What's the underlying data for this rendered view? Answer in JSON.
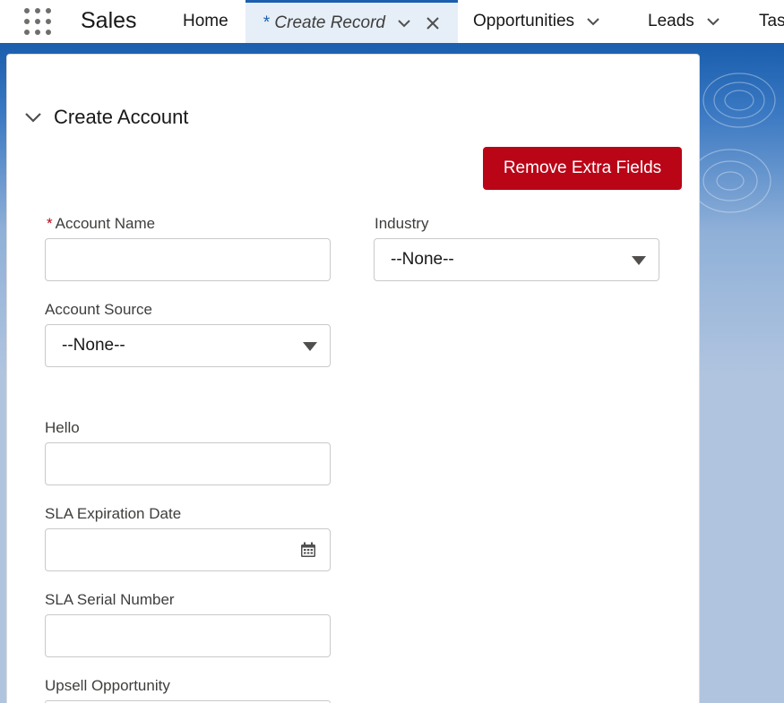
{
  "app": {
    "name": "Sales"
  },
  "nav": {
    "tabs": [
      {
        "label": "Home"
      },
      {
        "label": "Create Record",
        "unsaved_marker": "*"
      },
      {
        "label": "Opportunities"
      },
      {
        "label": "Leads"
      },
      {
        "label": "Tas"
      }
    ]
  },
  "section": {
    "title": "Create Account"
  },
  "actions": {
    "remove_extra_fields": "Remove Extra Fields"
  },
  "form": {
    "account_name": {
      "label": "Account Name",
      "required_marker": "*",
      "value": ""
    },
    "industry": {
      "label": "Industry",
      "value": "--None--"
    },
    "account_source": {
      "label": "Account Source",
      "value": "--None--"
    },
    "hello": {
      "label": "Hello",
      "value": ""
    },
    "sla_expiration_date": {
      "label": "SLA Expiration Date",
      "value": ""
    },
    "sla_serial_number": {
      "label": "SLA Serial Number",
      "value": ""
    },
    "upsell_opportunity": {
      "label": "Upsell Opportunity"
    }
  },
  "colors": {
    "brand": "#1b5fae",
    "destructive": "#ba0517",
    "required": "#ba0517"
  }
}
